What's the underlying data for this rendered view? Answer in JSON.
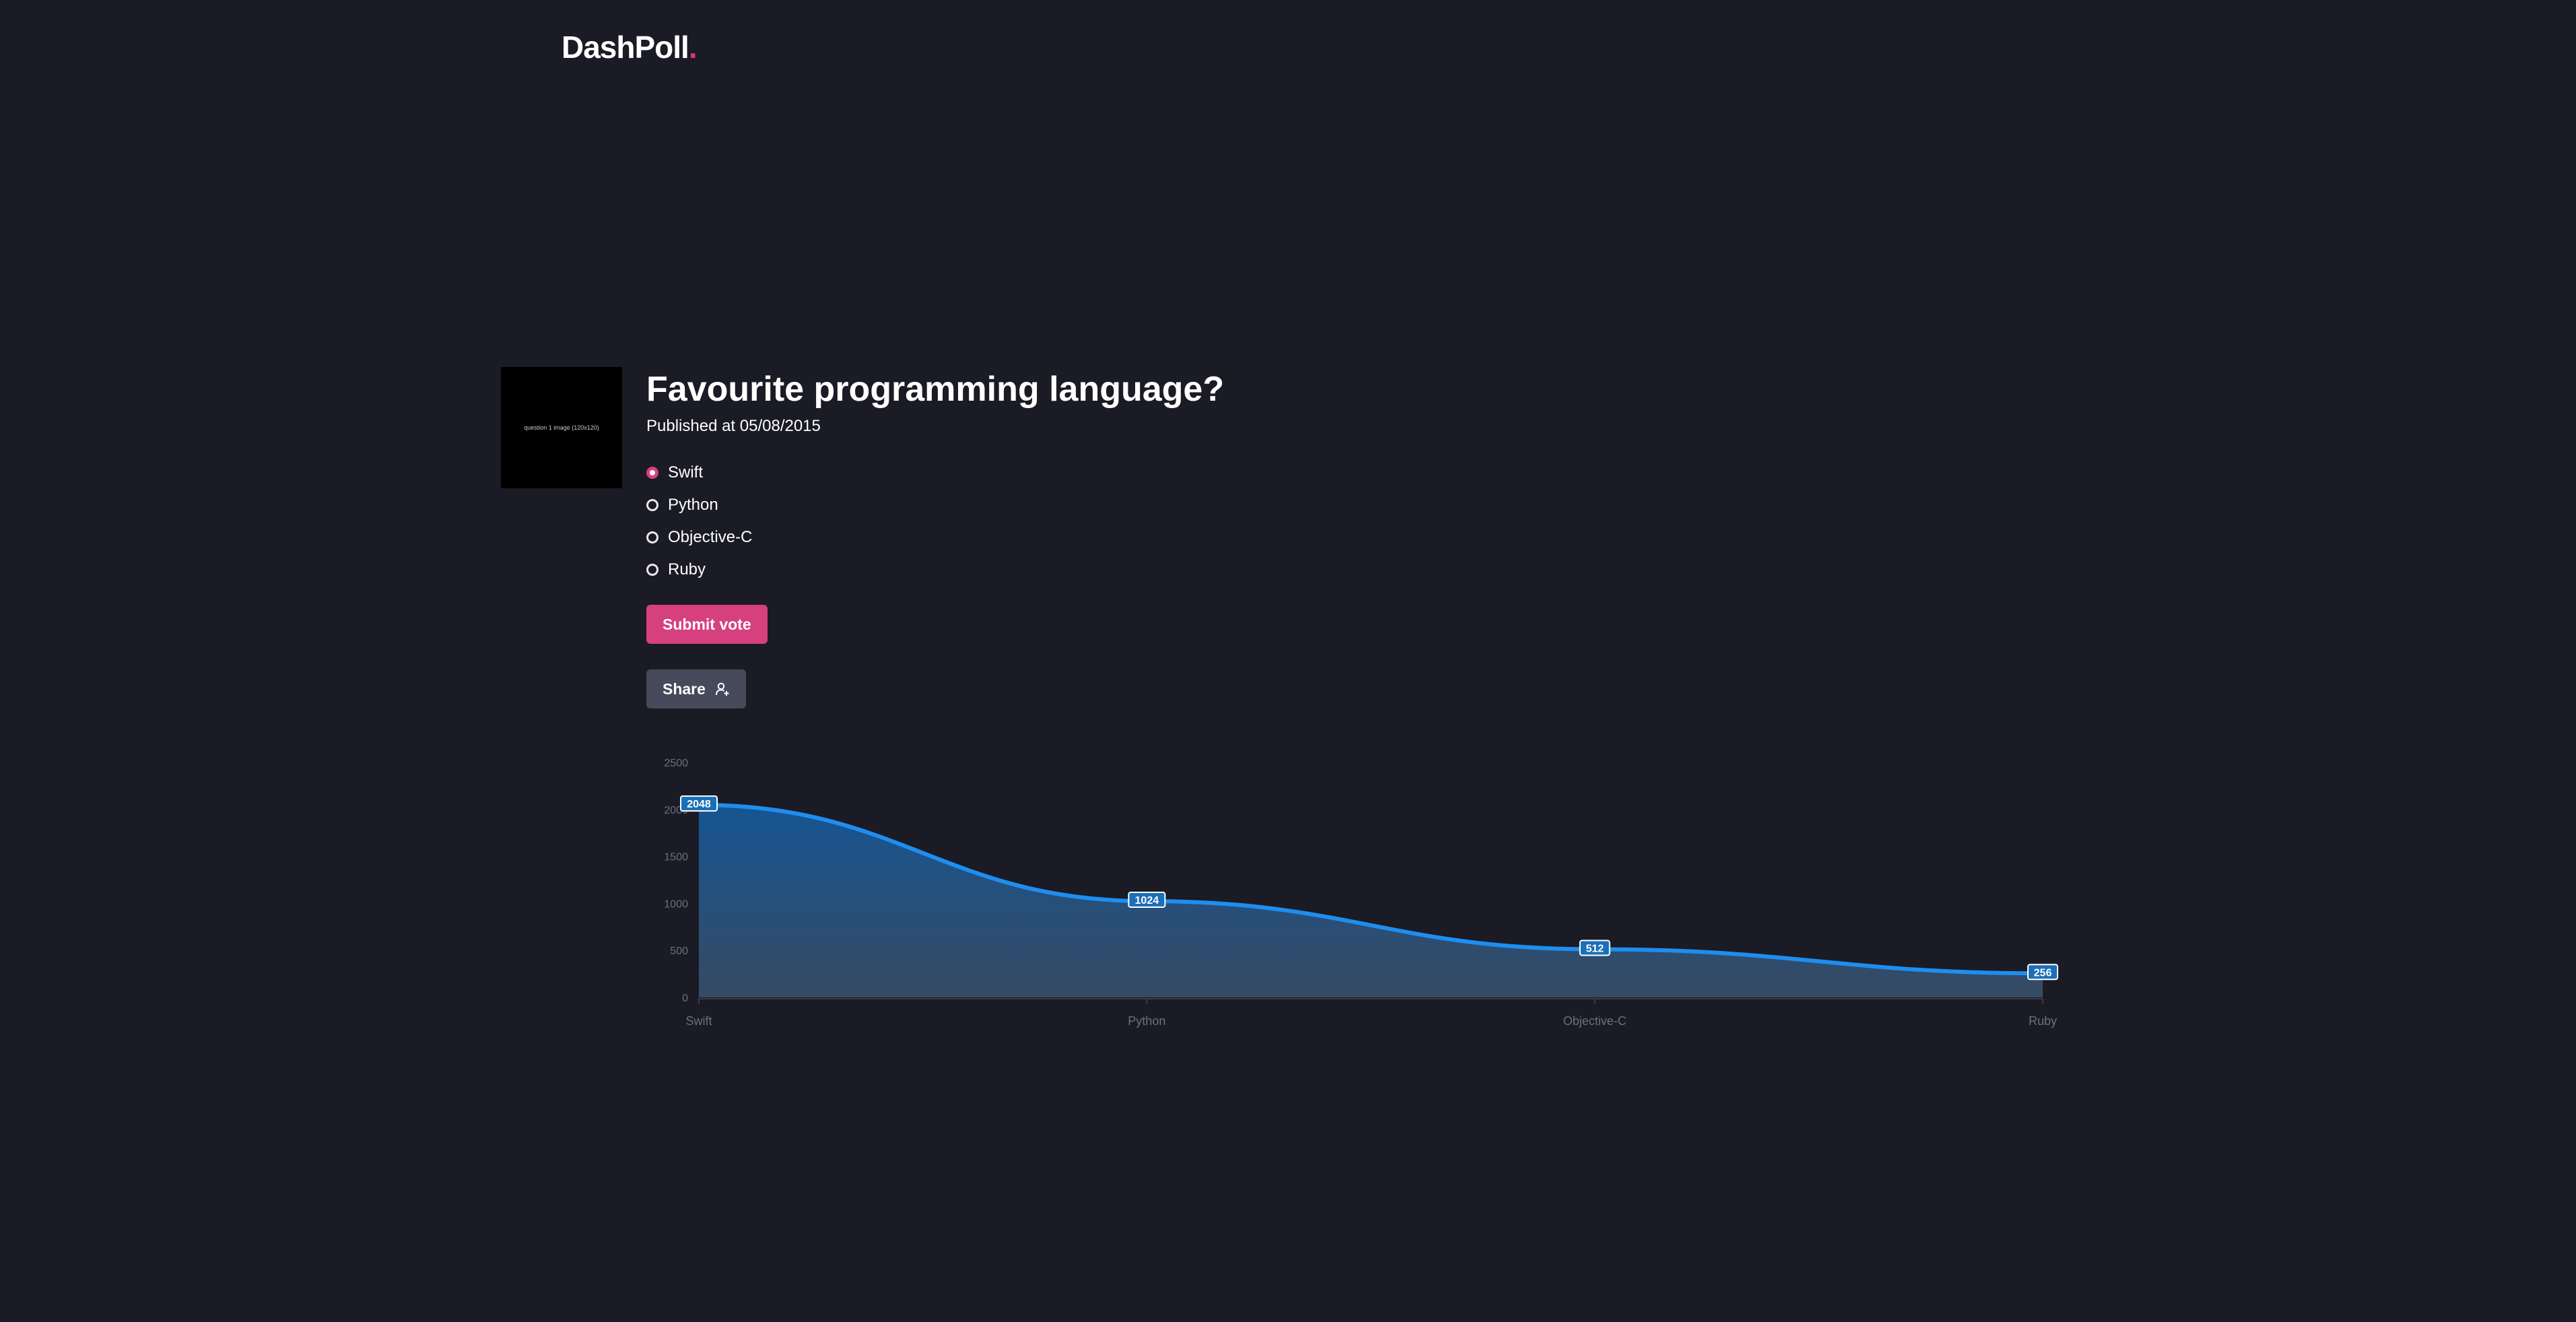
{
  "header": {
    "logo_text": "DashPoll",
    "logo_dot": "."
  },
  "poll": {
    "image_caption": "question 1 image (120x120)",
    "title": "Favourite programming language?",
    "published": "Published at 05/08/2015",
    "options": [
      {
        "label": "Swift",
        "selected": true
      },
      {
        "label": "Python",
        "selected": false
      },
      {
        "label": "Objective-C",
        "selected": false
      },
      {
        "label": "Ruby",
        "selected": false
      }
    ],
    "submit_label": "Submit vote",
    "share_label": "Share",
    "share_icon": "user-plus-icon"
  },
  "colors": {
    "background": "#1a1b24",
    "accent": "#d6407f",
    "share_bg": "#474a5a",
    "line": "#1e8ef0",
    "label_bg": "#1a6fb8"
  },
  "chart_data": {
    "type": "area",
    "categories": [
      "Swift",
      "Python",
      "Objective-C",
      "Ruby"
    ],
    "values": [
      2048,
      1024,
      512,
      256
    ],
    "data_labels": [
      "2048",
      "1024",
      "512",
      "256"
    ],
    "yticks": [
      0,
      500,
      1000,
      1500,
      2000,
      2500
    ],
    "ylim": [
      0,
      2500
    ],
    "grid": false,
    "legend": false,
    "curve": "smooth"
  }
}
